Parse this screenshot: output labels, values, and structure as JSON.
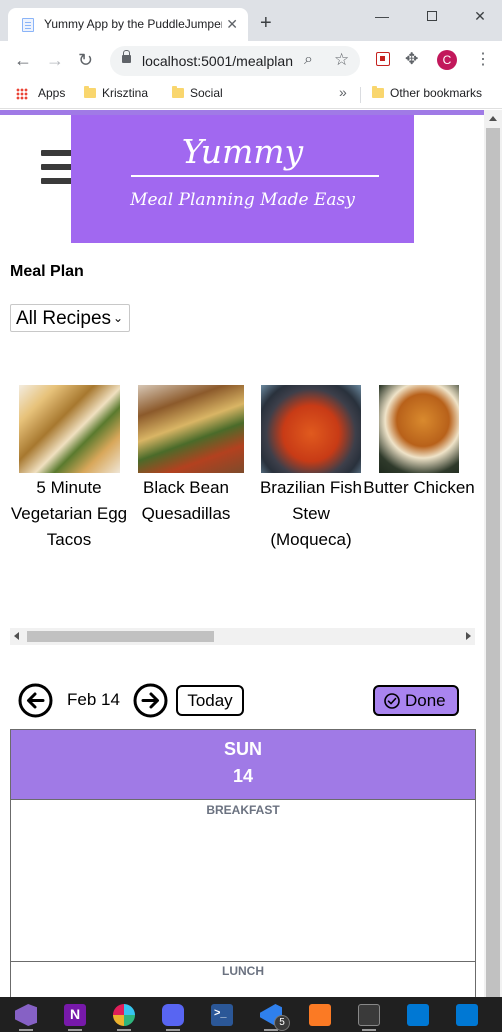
{
  "browser": {
    "tab_title": "Yummy App by the PuddleJumpers",
    "tab_close": "✕",
    "new_tab": "+",
    "url": "localhost:5001/mealplan",
    "profile_initial": "C",
    "window_min": "—",
    "window_close": "✕"
  },
  "bookmarks": {
    "items": [
      {
        "label": "Apps",
        "icon": "apps-grid-icon"
      },
      {
        "label": "Krisztina",
        "icon": "folder-icon"
      },
      {
        "label": "Social",
        "icon": "folder-icon"
      }
    ],
    "more": "»",
    "other": "Other bookmarks"
  },
  "banner": {
    "title": "Yummy",
    "subtitle": "Meal Planning Made Easy",
    "bg_color": "#a168f0"
  },
  "page": {
    "title": "Meal Plan",
    "filter": {
      "selected": "All Recipes",
      "chevron": "⌄"
    }
  },
  "recipes": [
    {
      "name": "5 Minute Vegetarian Egg Tacos",
      "image": "tacos-photo"
    },
    {
      "name": "Black Bean Quesadillas",
      "image": "quesadilla-photo"
    },
    {
      "name": "Brazilian Fish Stew (Moqueca)",
      "image": "moqueca-photo"
    },
    {
      "name": "Butter Chicken",
      "image": "butter-chicken-photo"
    }
  ],
  "date_nav": {
    "date": "Feb 14",
    "today_label": "Today",
    "done_label": "Done"
  },
  "day": {
    "name": "SUN",
    "number": "14",
    "header_color": "#a07ae6",
    "meals": [
      "BREAKFAST",
      "LUNCH"
    ]
  },
  "taskbar": {
    "badge_count": "5",
    "apps": [
      "visual-studio-icon",
      "onenote-icon",
      "slack-icon",
      "discord-icon",
      "powershell-icon",
      "vscode-icon",
      "xampp-icon",
      "terminal-icon",
      "mail-icon",
      "calendar-icon"
    ]
  }
}
